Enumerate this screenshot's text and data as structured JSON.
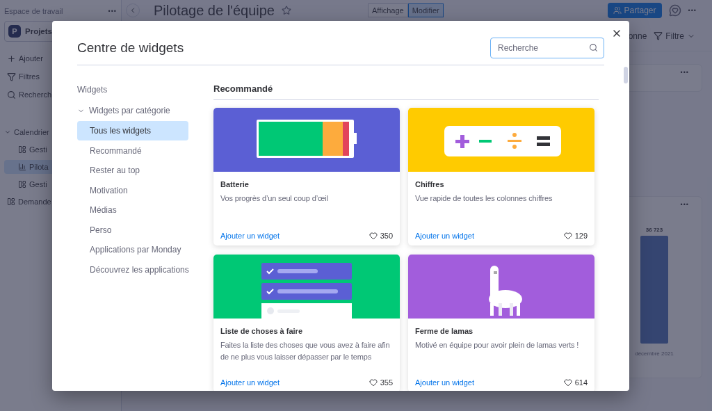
{
  "sidebar": {
    "label": "Espace de travail",
    "more": "•••",
    "workspace": {
      "badge": "P",
      "name": "Projets"
    },
    "actions": [
      {
        "kind": "add",
        "label": "Ajouter"
      },
      {
        "kind": "filter",
        "label": "Filtres"
      },
      {
        "kind": "search",
        "label": "Recherch"
      }
    ],
    "folders": [
      {
        "label": "Calendrier",
        "expanded": true,
        "children": [
          {
            "kind": "board",
            "label": "Gesti",
            "selected": false
          },
          {
            "kind": "dashboard",
            "label": "Pilota",
            "selected": true
          },
          {
            "kind": "board",
            "label": "Gesti",
            "selected": false
          }
        ]
      }
    ],
    "boards": [
      {
        "kind": "board",
        "label": "Demande",
        "selected": false
      }
    ]
  },
  "header": {
    "title": "Pilotage de l'équipe",
    "view_toggle": [
      {
        "label": "Affichage",
        "selected": false
      },
      {
        "label": "Modifier",
        "selected": true
      }
    ],
    "share_button": "Partager",
    "more": "•••"
  },
  "toolbar": {
    "column_button": "onne",
    "filter_button": "Filtre"
  },
  "panels": [
    {
      "more": "•••"
    },
    {
      "more": "•••",
      "bar": {
        "label": "36 723",
        "category": "décembre 2021"
      }
    }
  ],
  "modal": {
    "title": "Centre de widgets",
    "search": {
      "placeholder": "Recherche"
    },
    "nav": {
      "heading": "Widgets",
      "group": {
        "label": "Widgets par catégorie",
        "expanded": true,
        "items": [
          {
            "label": "Tous les widgets",
            "selected": true
          },
          {
            "label": "Recommandé",
            "selected": false
          },
          {
            "label": "Rester au top",
            "selected": false
          },
          {
            "label": "Motivation",
            "selected": false
          },
          {
            "label": "Médias",
            "selected": false
          },
          {
            "label": "Perso",
            "selected": false
          },
          {
            "label": "Applications par Monday",
            "selected": false
          },
          {
            "label": "Découvrez les applications",
            "selected": false
          }
        ]
      }
    },
    "section_title": "Recommandé",
    "widgets": [
      {
        "kind": "battery",
        "color": "#5b5fd4",
        "title": "Batterie",
        "description": "Vos progrès d’un seul coup d’œil",
        "action": "Ajouter un widget",
        "likes": "350"
      },
      {
        "kind": "numbers",
        "color": "#ffcb00",
        "title": "Chiffres",
        "description": "Vue rapide de toutes les colonnes chiffres",
        "action": "Ajouter un widget",
        "likes": "129"
      },
      {
        "kind": "todo",
        "color": "#00c875",
        "title": "Liste de choses à faire",
        "description": "Faites la liste des choses que vous avez à faire afin de ne plus vous laisser dépasser par le temps",
        "action": "Ajouter un widget",
        "likes": "355"
      },
      {
        "kind": "llama",
        "color": "#a25ddc",
        "title": "Ferme de lamas",
        "description": "Motivé en équipe pour avoir plein de lamas verts !",
        "action": "Ajouter un widget",
        "likes": "614"
      }
    ]
  }
}
